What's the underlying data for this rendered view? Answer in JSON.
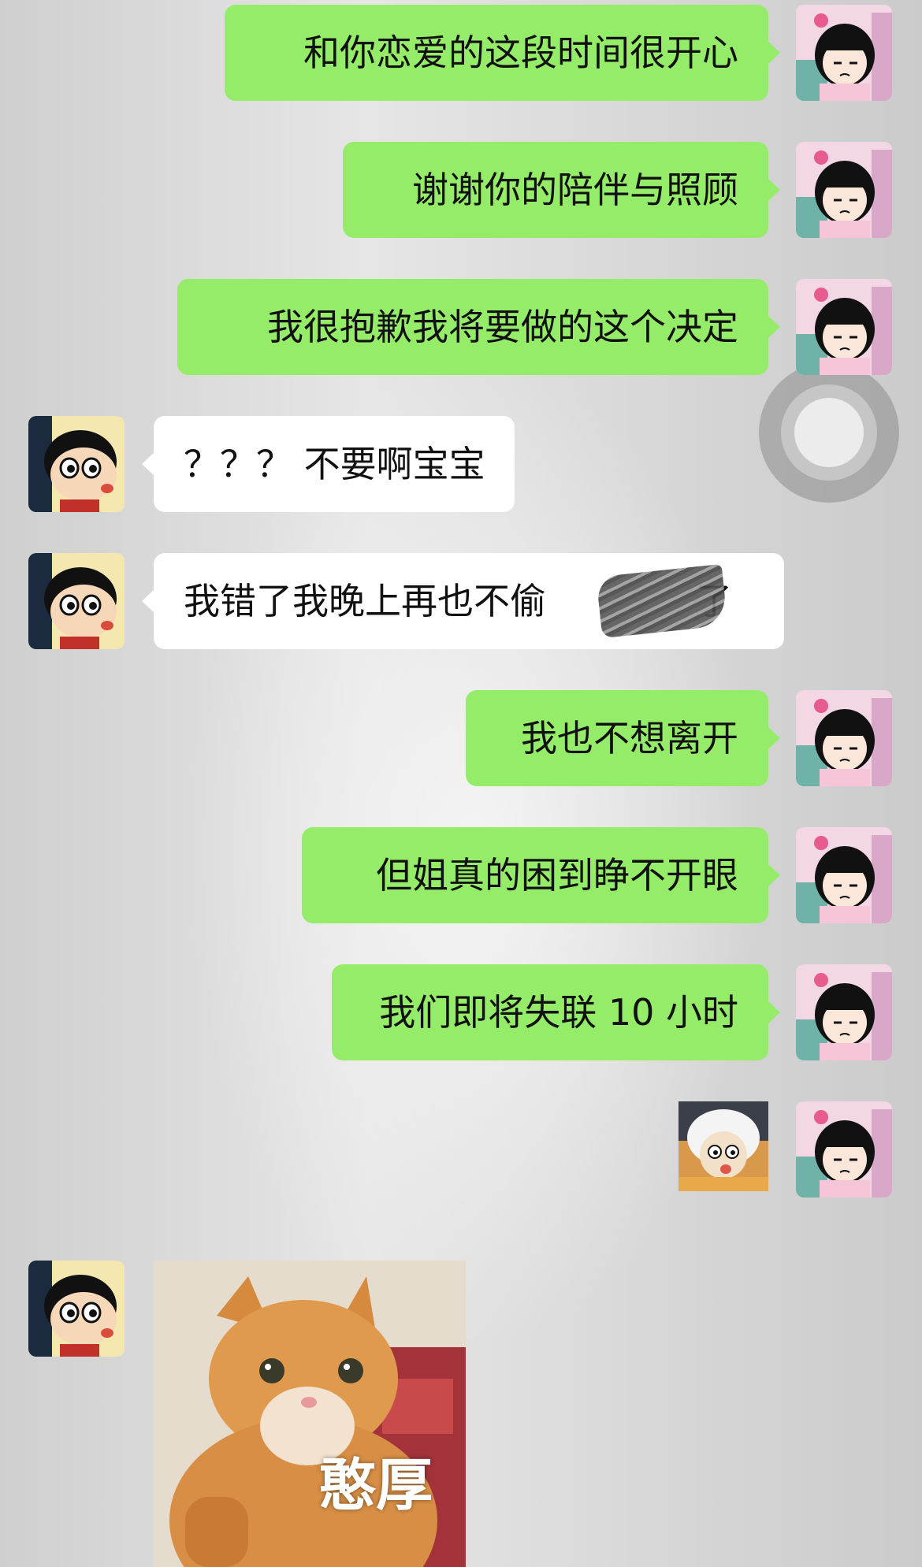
{
  "chat": {
    "messages": [
      {
        "side": "right",
        "kind": "text",
        "text": "和你恋爱的这段时间很开心"
      },
      {
        "side": "right",
        "kind": "text",
        "text": "谢谢你的陪伴与照顾"
      },
      {
        "side": "right",
        "kind": "text",
        "text": "我很抱歉我将要做的这个决定"
      },
      {
        "side": "left",
        "kind": "text",
        "text": "？？？ 不要啊宝宝"
      },
      {
        "side": "left",
        "kind": "text",
        "text": "我错了我晚上再也不偷"
      },
      {
        "side": "right",
        "kind": "text",
        "text": "我也不想离开"
      },
      {
        "side": "right",
        "kind": "text",
        "text": "但姐真的困到睁不开眼"
      },
      {
        "side": "right",
        "kind": "text",
        "text": "我们即将失联 10 小时"
      },
      {
        "side": "right",
        "kind": "sticker",
        "icon": "sheep-sticker"
      },
      {
        "side": "left",
        "kind": "image",
        "caption": "憨厚",
        "icon": "orange-cat-meme"
      }
    ],
    "censored_tail": "了"
  },
  "avatars": {
    "self": "girl-cartoon-avatar",
    "other": "boy-cartoon-avatar"
  },
  "colors": {
    "sent_bubble": "#95ec69",
    "received_bubble": "#ffffff"
  }
}
